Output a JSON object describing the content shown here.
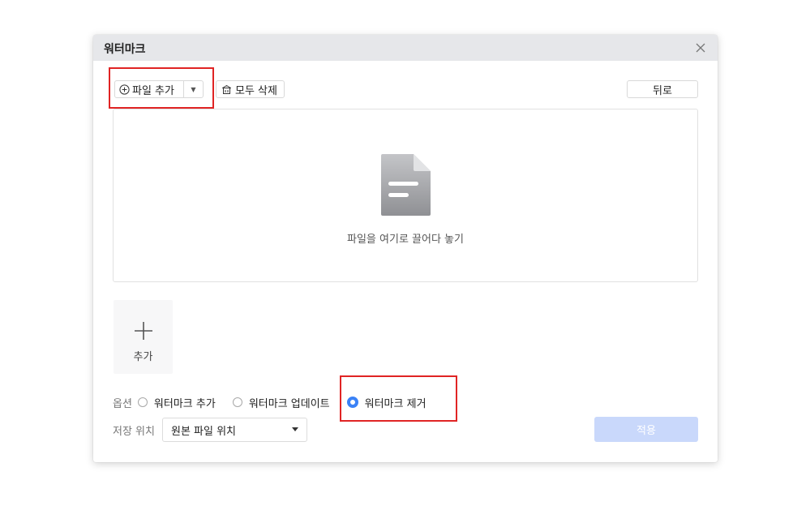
{
  "dialog": {
    "title": "워터마크",
    "close_icon": "close-icon"
  },
  "toolbar": {
    "add_file_label": "파일 추가",
    "add_file_icon": "plus-circle-icon",
    "add_file_dropdown_icon": "caret-down-icon",
    "delete_all_label": "모두 삭제",
    "delete_all_icon": "trash-icon",
    "back_label": "뒤로"
  },
  "dropzone": {
    "icon": "document-icon",
    "text": "파일을 여기로 끌어다 놓기"
  },
  "add_tile": {
    "icon": "plus-icon",
    "label": "추가"
  },
  "options": {
    "label": "옵션",
    "items": [
      {
        "label": "워터마크 추가",
        "checked": false
      },
      {
        "label": "워터마크 업데이트",
        "checked": false
      },
      {
        "label": "워터마크 제거",
        "checked": true
      }
    ]
  },
  "save": {
    "label": "저장 위치",
    "selected": "원본 파일 위치"
  },
  "apply_label": "적용",
  "colors": {
    "accent": "#3b82f6",
    "apply_disabled_bg": "#c9d8fb",
    "highlight": "#e02424",
    "titlebar": "#e6e7ea"
  }
}
